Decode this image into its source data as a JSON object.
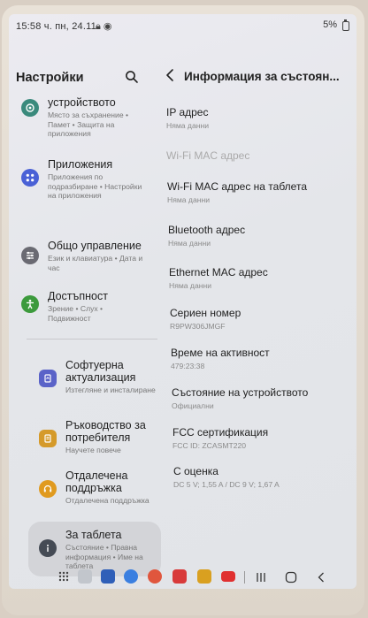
{
  "status_bar": {
    "time": "15:58 ч.",
    "date": "пн, 24.11",
    "battery": "5%"
  },
  "left_panel": {
    "title": "Настройки",
    "items": [
      {
        "title": "устройството",
        "subtitle": "Място за съхранение • Памет • Защита на приложения",
        "icon": "device-care-icon",
        "color": "#3a8a7c"
      },
      {
        "title": "Приложения",
        "subtitle": "Приложения по подразбиране • Настройки на приложения",
        "icon": "apps-icon",
        "color": "#4a61d6"
      },
      {
        "title": "Общо управление",
        "subtitle": "Език и клавиатура • Дата и час",
        "icon": "sliders-icon",
        "color": "#6a6a72"
      },
      {
        "title": "Достъпност",
        "subtitle": "Зрение • Слух • Подвижност",
        "icon": "accessibility-icon",
        "color": "#3c9a3c"
      },
      {
        "title": "Софтуерна актуализация",
        "subtitle": "Изтегляне и инсталиране",
        "icon": "software-update-icon",
        "color": "#5a63c8"
      },
      {
        "title": "Ръководство за потребителя",
        "subtitle": "Научете повече",
        "icon": "user-manual-icon",
        "color": "#d59a2a"
      },
      {
        "title": "Отдалечена поддръжка",
        "subtitle": "Отдалечена поддръжка",
        "icon": "remote-support-icon",
        "color": "#e09a1f"
      },
      {
        "title": "За таблета",
        "subtitle": "Състояние • Правна информация • Име на таблета",
        "icon": "info-icon",
        "color": "#454b55"
      }
    ]
  },
  "right_panel": {
    "title": "Информация за състоян...",
    "items": [
      {
        "label": "IP адрес",
        "value": "Няма данни",
        "disabled": false
      },
      {
        "label": "Wi-Fi MAC адрес",
        "value": "",
        "disabled": true
      },
      {
        "label": "Wi-Fi MAC адрес на таблета",
        "value": "Няма данни",
        "disabled": false
      },
      {
        "label": "Bluetooth адрес",
        "value": "Няма данни",
        "disabled": false
      },
      {
        "label": "Ethernet MAC адрес",
        "value": "Няма данни",
        "disabled": false
      },
      {
        "label": "Сериен номер",
        "value": "R9PW306JMGF",
        "disabled": false
      },
      {
        "label": "Време на активност",
        "value": "479:23:38",
        "disabled": false
      },
      {
        "label": "Състояние на устройството",
        "value": "Официални",
        "disabled": false
      },
      {
        "label": "FCC сертификация",
        "value": "FCC ID: ZCASMT220",
        "disabled": false
      },
      {
        "label": "С оценка",
        "value": "DC 5 V; 1,55 A / DC 9 V; 1,67 A",
        "disabled": false
      }
    ]
  },
  "nav_bar": {
    "apps": [
      {
        "name": "app-drawer-icon",
        "color": "#444"
      },
      {
        "name": "folder-icon",
        "color": "#9aa0a8"
      },
      {
        "name": "calendar-icon",
        "color": "#2f5fb8"
      },
      {
        "name": "messages-icon",
        "color": "#3a7fe0"
      },
      {
        "name": "contacts-icon",
        "color": "#e0563d"
      },
      {
        "name": "camera-icon",
        "color": "#d83a3a"
      },
      {
        "name": "store-icon",
        "color": "#d9a020"
      },
      {
        "name": "youtube-icon",
        "color": "#e03030"
      }
    ],
    "buttons": [
      "recents-button",
      "home-button",
      "back-button"
    ]
  }
}
